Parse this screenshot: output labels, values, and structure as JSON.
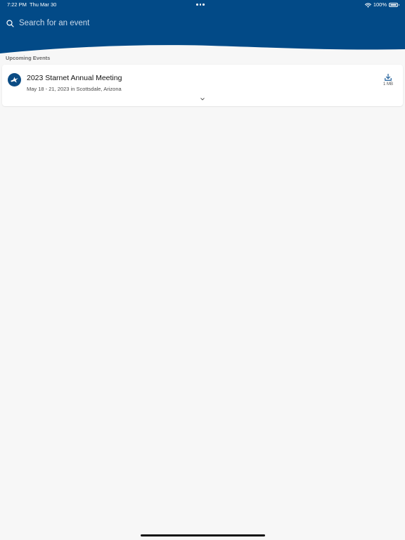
{
  "status_bar": {
    "time": "7:22 PM",
    "date": "Thu Mar 30",
    "battery_text": "100%",
    "battery_level": 1.0,
    "icons": [
      "multitasking-dots-icon",
      "wifi-icon",
      "battery-icon"
    ]
  },
  "search": {
    "placeholder": "Search for an event",
    "icon": "search-icon"
  },
  "section": {
    "heading": "Upcoming Events"
  },
  "events": [
    {
      "title": "2023 Starnet Annual Meeting",
      "subtitle": "May 18 - 21, 2023 in Scottsdale, Arizona",
      "download_size": "1 MB",
      "logo_icon": "starnet-logo-icon",
      "download_icon": "download-icon",
      "expand_icon": "chevron-down-icon"
    }
  ],
  "colors": {
    "header": "#024a87",
    "background": "#f7f7f7",
    "accent": "#1f5f9a",
    "card": "#ffffff"
  }
}
